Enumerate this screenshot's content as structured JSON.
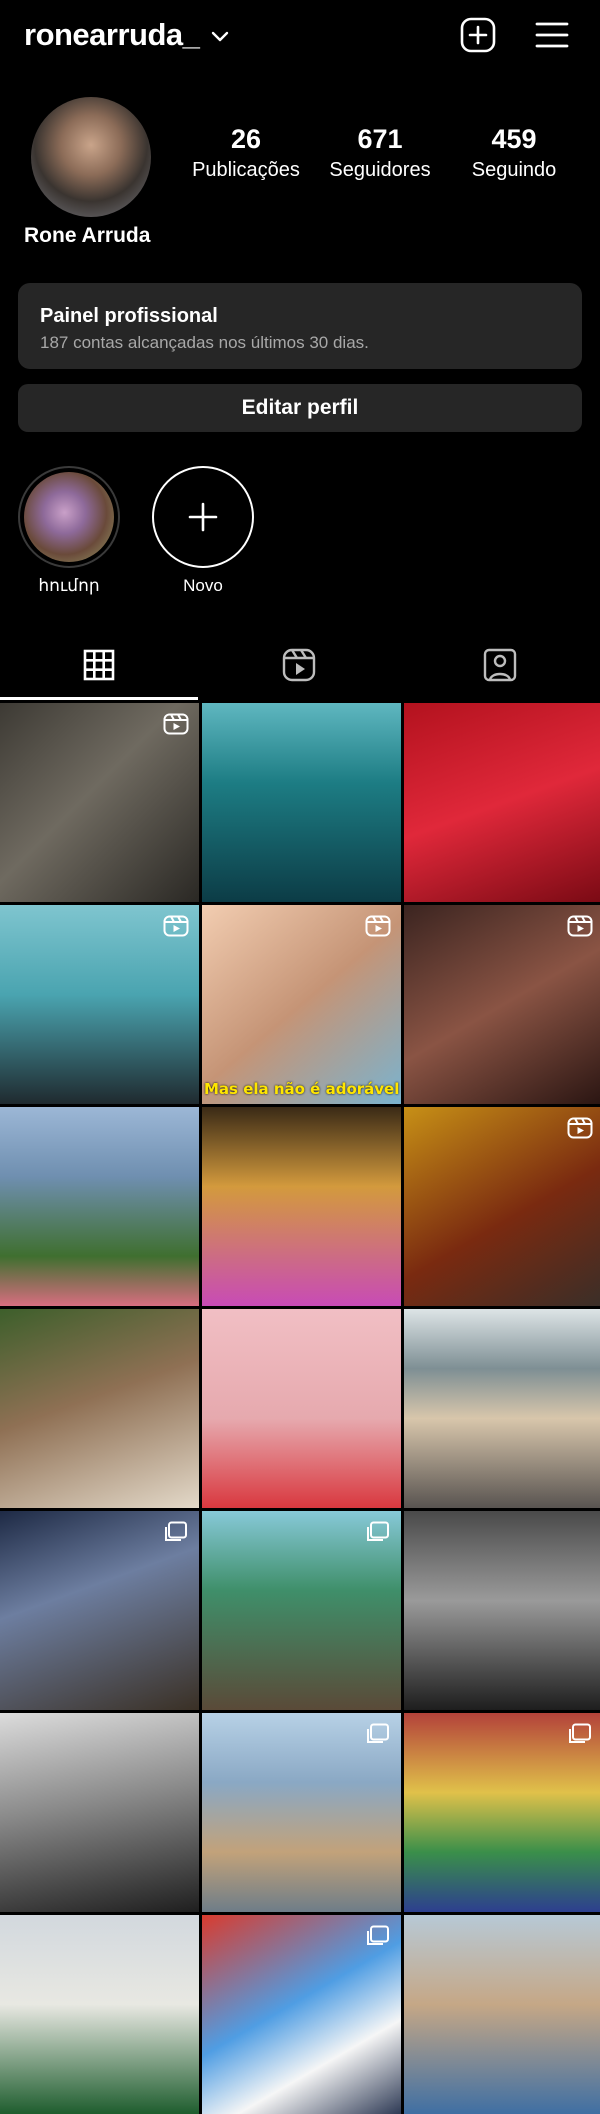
{
  "header": {
    "username": "ronearruda_",
    "create_icon": "plus-square-icon",
    "menu_icon": "hamburger-menu-icon"
  },
  "profile": {
    "name": "Rone Arruda",
    "stats": [
      {
        "value": "26",
        "label": "Publicações"
      },
      {
        "value": "671",
        "label": "Seguidores"
      },
      {
        "value": "459",
        "label": "Seguindo"
      }
    ]
  },
  "dashboard": {
    "title": "Painel profissional",
    "subtitle": "187 contas alcançadas nos últimos 30 dias."
  },
  "edit_profile_label": "Editar perfil",
  "highlights": [
    {
      "label": "հումոր"
    },
    {
      "label": "Novo"
    }
  ],
  "tabs": [
    {
      "name": "grid",
      "icon": "grid-icon",
      "active": true
    },
    {
      "name": "reels",
      "icon": "reels-icon",
      "active": false
    },
    {
      "name": "tagged",
      "icon": "tagged-user-icon",
      "active": false
    }
  ],
  "posts": [
    {
      "bg": "linear-gradient(135deg,#3d3a34 0%,#6f6a60 45%,#2a2824 100%)",
      "badge": "reel"
    },
    {
      "bg": "linear-gradient(180deg,#5fb7c0 0%,#1d7d84 40%,#0c3c46 100%)",
      "badge": ""
    },
    {
      "bg": "linear-gradient(160deg,#b3121e 0%,#e0283a 50%,#7a0a14 100%)",
      "badge": ""
    },
    {
      "bg": "linear-gradient(180deg,#7fc5cf 0%,#4aa4b0 45%,#1f2a2f 100%)",
      "badge": "reel"
    },
    {
      "bg": "linear-gradient(140deg,#f2cdb1 0%,#c59476 50%,#7ab3cf 100%)",
      "badge": "reel",
      "caption": "Mas ela não é adorável"
    },
    {
      "bg": "linear-gradient(150deg,#3b2420 0%,#8a5444 50%,#2a1512 100%)",
      "badge": "reel"
    },
    {
      "bg": "linear-gradient(180deg,#9cb7d6 0%,#6f8fb0 35%,#3f6f2f 75%,#d86e80 100%)",
      "badge": ""
    },
    {
      "bg": "linear-gradient(180deg,#3a2a16 0%,#d39a3d 40%,#c84bb6 100%)",
      "badge": ""
    },
    {
      "bg": "linear-gradient(150deg,#c79016 0%,#7a2a10 55%,#3a2e28 100%)",
      "badge": "reel"
    },
    {
      "bg": "linear-gradient(160deg,#3d5f2b 0%,#8f7054 45%,#e3d9c9 100%)",
      "badge": ""
    },
    {
      "bg": "linear-gradient(180deg,#f1bfc4 0%,#e6a9ae 55%,#d9383f 100%)",
      "badge": ""
    },
    {
      "bg": "linear-gradient(180deg,#dde4e6 0%,#7e8f94 30%,#d8c6ab 55%,#595451 100%)",
      "badge": ""
    },
    {
      "bg": "linear-gradient(160deg,#1e2a45 0%,#6d7ea0 40%,#3a3025 100%)",
      "badge": "multi"
    },
    {
      "bg": "linear-gradient(180deg,#87c9d8 0%,#3f8f6a 40%,#5a4a38 100%)",
      "badge": "multi"
    },
    {
      "bg": "linear-gradient(180deg,#4a4a4a 0%,#9a9a9a 45%,#1e1e1e 100%)",
      "badge": ""
    },
    {
      "bg": "linear-gradient(170deg,#dcdcdc 0%,#8a8a8a 45%,#1f1f1f 100%)",
      "badge": ""
    },
    {
      "bg": "linear-gradient(180deg,#b7d1e6 0%,#8aa8c4 35%,#c2a27a 70%,#6e7d88 100%)",
      "badge": "multi"
    },
    {
      "bg": "linear-gradient(180deg,#b3423a 0%,#e0c14a 40%,#3a8f4a 70%,#2d3f8f 100%)",
      "badge": "multi"
    },
    {
      "bg": "linear-gradient(180deg,#d2d8de 0%,#e8e8e2 45%,#1e5d2e 100%)",
      "badge": ""
    },
    {
      "bg": "linear-gradient(150deg,#d93b2e 0%,#4f9de3 45%,#f6f6f6 70%,#2e3a55 100%)",
      "badge": "multi"
    },
    {
      "bg": "linear-gradient(180deg,#b7c9d6 0%,#c5a786 45%,#3f6fa3 100%)",
      "badge": ""
    }
  ]
}
